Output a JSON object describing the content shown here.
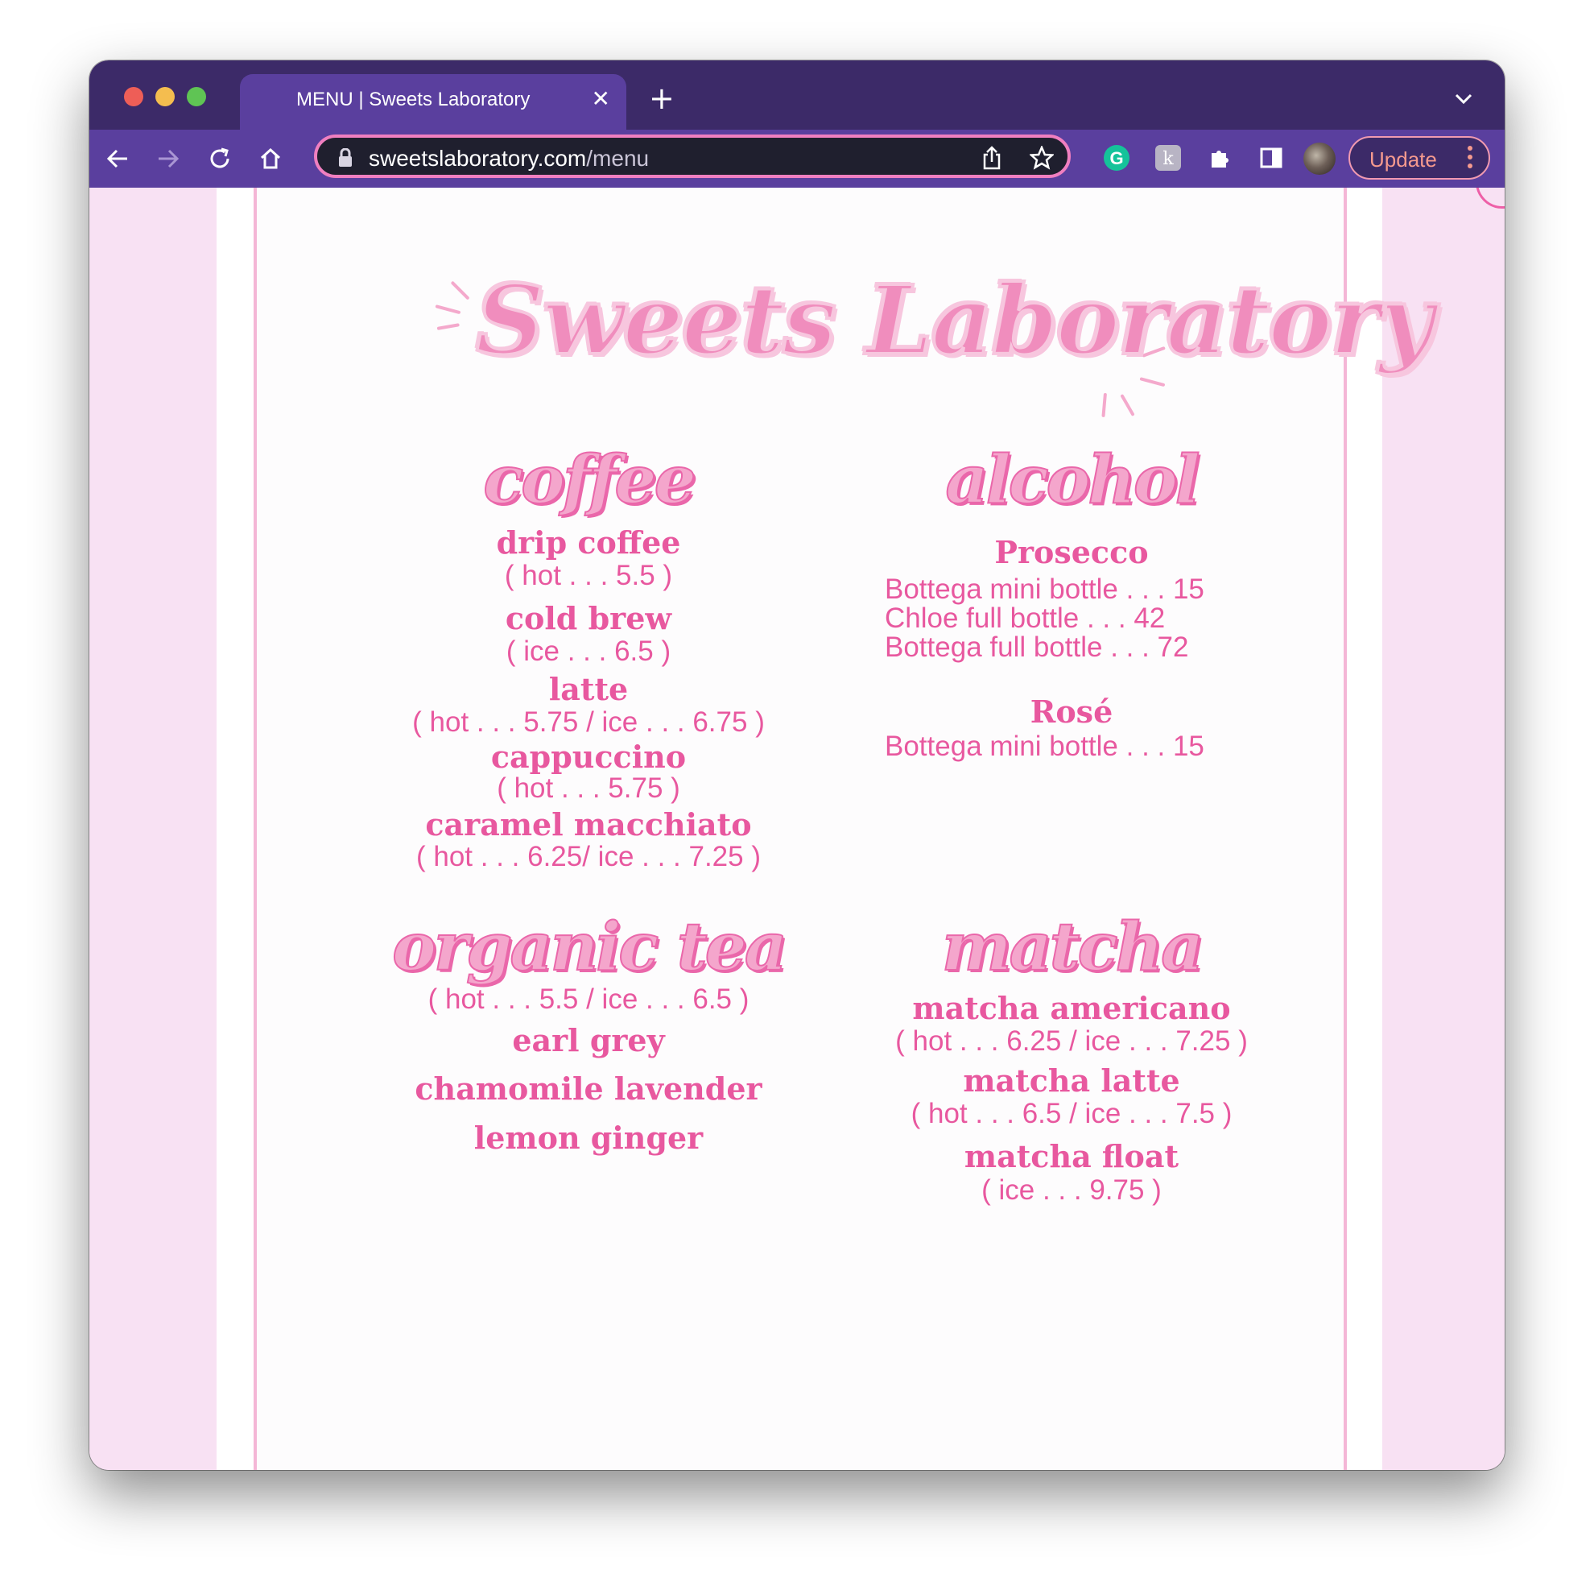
{
  "browser": {
    "tab_title": "MENU | Sweets Laboratory",
    "tab_close": "✕",
    "new_tab": "+",
    "url_host": "sweetslaboratory.com",
    "url_path": "/menu",
    "update_label": "Update",
    "ext_grammarly": "G",
    "ext_k": "k"
  },
  "page": {
    "logo_text": "Sweets Laboratory",
    "coffee": {
      "title": "coffee",
      "items": [
        {
          "name": "drip coffee",
          "price": "( hot . . . 5.5 )"
        },
        {
          "name": "cold brew",
          "price": "( ice . . . 6.5 )"
        },
        {
          "name": "latte",
          "price": "( hot . . . 5.75 / ice . . . 6.75 )"
        },
        {
          "name": "cappuccino",
          "price": "( hot . . . 5.75 )"
        },
        {
          "name": "caramel macchiato",
          "price": "( hot . . . 6.25/ ice . . . 7.25 )"
        }
      ]
    },
    "alcohol": {
      "title": "alcohol",
      "groups": [
        {
          "name": "Prosecco",
          "lines": [
            "Bottega mini bottle . . . 15",
            "Chloe full bottle . . . 42",
            "Bottega full bottle . . . 72"
          ]
        },
        {
          "name": "Rosé",
          "lines": [
            "Bottega mini bottle . . . 15"
          ]
        }
      ]
    },
    "tea": {
      "title": "organic tea",
      "price": "( hot . . . 5.5 / ice . . . 6.5 )",
      "items": [
        "earl grey",
        "chamomile lavender",
        "lemon ginger"
      ]
    },
    "matcha": {
      "title": "matcha",
      "items": [
        {
          "name": "matcha americano",
          "price": "( hot . . . 6.25 / ice . . . 7.25 )"
        },
        {
          "name": "matcha latte",
          "price": "( hot . . . 6.5 / ice . . . 7.5 )"
        },
        {
          "name": "matcha float",
          "price": "( ice . . . 9.75 )"
        }
      ]
    }
  }
}
